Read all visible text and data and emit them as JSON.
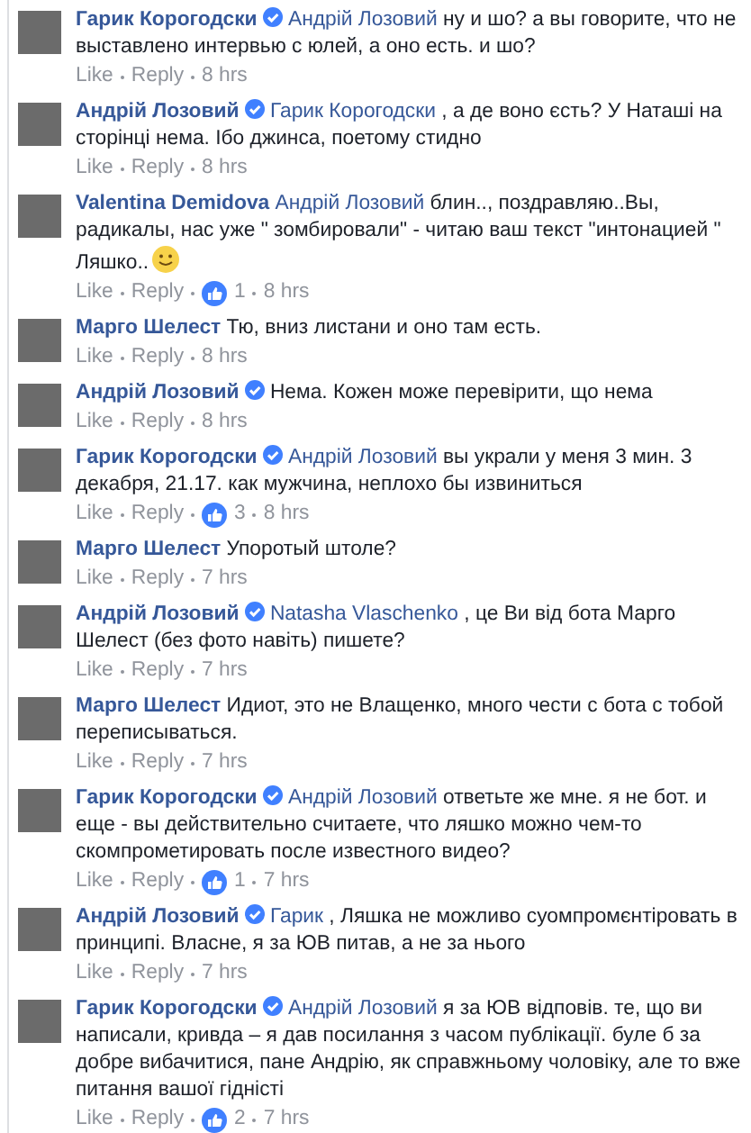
{
  "comments": [
    {
      "author": "Гарик Корогодски",
      "verified": true,
      "mention": "Андрій Лозовий",
      "text": "ну и шо? а вы говорите, что не выставлено интервью с юлей, а оно есть. и шо?",
      "like": "Like",
      "reply": "Reply",
      "time": "8 hrs"
    },
    {
      "author": "Андрій Лозовий",
      "verified": true,
      "mention": "Гарик Корогодски",
      "text": ", а де воно єсть? У Наташі на сторінці нема. Ібо джинса, поетому стидно",
      "like": "Like",
      "reply": "Reply",
      "time": "8 hrs"
    },
    {
      "author": "Valentina Demidova",
      "verified": false,
      "mention": "Андрій Лозовий",
      "text": "блин.., поздравляю..Вы, радикалы, нас уже \" зомбировали\" - читаю ваш текст \"интонацией \" Ляшко..",
      "smiley": true,
      "like": "Like",
      "reply": "Reply",
      "reactions": "1",
      "time": "8 hrs"
    },
    {
      "author": "Марго Шелест",
      "verified": false,
      "text": "Тю, вниз листани и оно там есть.",
      "like": "Like",
      "reply": "Reply",
      "time": "8 hrs"
    },
    {
      "author": "Андрій Лозовий",
      "verified": true,
      "text": "Нема. Кожен може перевірити, що нема",
      "like": "Like",
      "reply": "Reply",
      "time": "8 hrs"
    },
    {
      "author": "Гарик Корогодски",
      "verified": true,
      "mention": "Андрій Лозовий",
      "text": "вы украли у меня 3 мин. 3 декабря, 21.17. как мужчина, неплохо бы извиниться",
      "like": "Like",
      "reply": "Reply",
      "reactions": "3",
      "time": "8 hrs"
    },
    {
      "author": "Марго Шелест",
      "verified": false,
      "text": "Упоротый штоле?",
      "like": "Like",
      "reply": "Reply",
      "time": "7 hrs"
    },
    {
      "author": "Андрій Лозовий",
      "verified": true,
      "mention": "Natasha Vlaschenko",
      "text": ", це Ви від бота Марго Шелест (без фото навіть) пишете?",
      "like": "Like",
      "reply": "Reply",
      "time": "7 hrs"
    },
    {
      "author": "Марго Шелест",
      "verified": false,
      "text": "Идиот, это не Влащенко, много чести с бота с тобой переписываться.",
      "like": "Like",
      "reply": "Reply",
      "time": "7 hrs"
    },
    {
      "author": "Гарик Корогодски",
      "verified": true,
      "mention": "Андрій Лозовий",
      "text": "ответьте же мне. я не бот. и еще - вы действительно считаете, что ляшко можно чем-то скомпрометировать после известного видео?",
      "like": "Like",
      "reply": "Reply",
      "reactions": "1",
      "time": "7 hrs"
    },
    {
      "author": "Андрій Лозовий",
      "verified": true,
      "mention": "Гарик",
      "text": ", Ляшка не можливо суомпромєнтіровать в принципі. Власне, я за ЮВ питав, а не за нього",
      "like": "Like",
      "reply": "Reply",
      "time": "7 hrs"
    },
    {
      "author": "Гарик Корогодски",
      "verified": true,
      "mention": "Андрій Лозовий",
      "text": "я за ЮВ відповів. те, що ви написали, кривда – я дав посилання з часом публікації. буле б за добре вибачитися, пане Андрію, як справжньому чоловіку, але то вже питання вашої гідністі",
      "like": "Like",
      "reply": "Reply",
      "reactions": "2",
      "time": "7 hrs"
    }
  ]
}
